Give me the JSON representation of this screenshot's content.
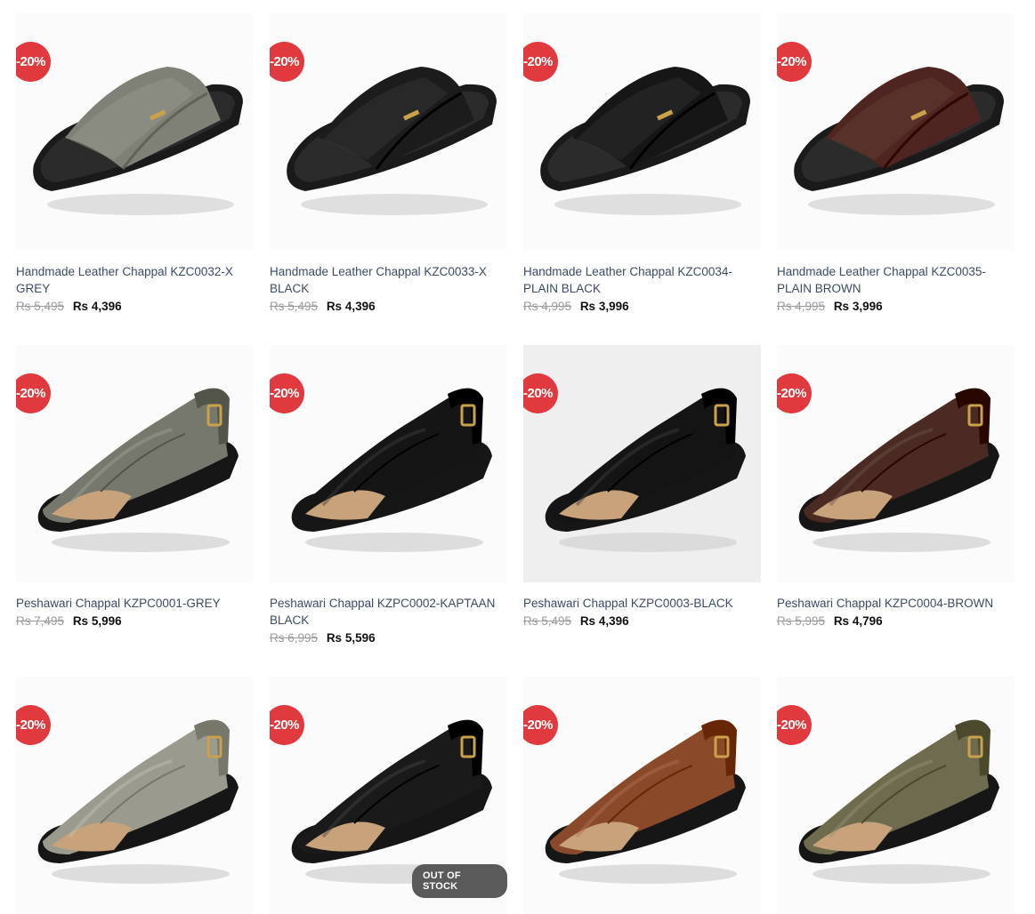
{
  "colors": {
    "badge": "#e03a3e",
    "title": "#3b4b66",
    "old_price": "#9a9a9a",
    "new_price": "#111111",
    "out_of_stock": "#5a5a5a"
  },
  "products": [
    {
      "title": "Handmade Leather Chappal KZC0032-X GREY",
      "old_price": "Rs 5,495",
      "price": "Rs 4,396",
      "discount": "-20%",
      "color": "#7f8076",
      "style": "slide",
      "image_icon": "grey-cross-strap-chappal-icon"
    },
    {
      "title": "Handmade Leather Chappal KZC0033-X BLACK",
      "old_price": "Rs 5,495",
      "price": "Rs 4,396",
      "discount": "-20%",
      "color": "#1c1c1c",
      "style": "slide",
      "image_icon": "black-cross-strap-chappal-icon"
    },
    {
      "title": "Handmade Leather Chappal KZC0034-PLAIN BLACK",
      "old_price": "Rs 4,995",
      "price": "Rs 3,996",
      "discount": "-20%",
      "color": "#161616",
      "style": "slide",
      "image_icon": "black-plain-chappal-icon"
    },
    {
      "title": "Handmade Leather Chappal KZC0035-PLAIN BROWN",
      "old_price": "Rs 4,995",
      "price": "Rs 3,996",
      "discount": "-20%",
      "color": "#4e2520",
      "style": "slide",
      "image_icon": "brown-plain-chappal-icon"
    },
    {
      "title": "Peshawari Chappal KZPC0001-GREY",
      "old_price": "Rs 7,495",
      "price": "Rs 5,996",
      "discount": "-20%",
      "color": "#76786d",
      "style": "peshawari",
      "image_icon": "grey-peshawari-chappal-icon"
    },
    {
      "title": "Peshawari Chappal KZPC0002-KAPTAAN BLACK",
      "old_price": "Rs 6,995",
      "price": "Rs 5,596",
      "discount": "-20%",
      "color": "#151515",
      "style": "peshawari",
      "image_icon": "black-kaptaan-chappal-icon"
    },
    {
      "title": "Peshawari Chappal KZPC0003-BLACK",
      "old_price": "Rs 5,495",
      "price": "Rs 4,396",
      "discount": "-20%",
      "color": "#141414",
      "style": "peshawari",
      "image_icon": "black-peshawari-chappal-icon"
    },
    {
      "title": "Peshawari Chappal KZPC0004-BROWN",
      "old_price": "Rs 5,995",
      "price": "Rs 4,796",
      "discount": "-20%",
      "color": "#4a2a22",
      "style": "peshawari",
      "image_icon": "brown-peshawari-chappal-icon"
    },
    {
      "title": "",
      "old_price": "",
      "price": "",
      "discount": "-20%",
      "color": "#9b9a8e",
      "style": "peshawari",
      "image_icon": "grey-suede-peshawari-chappal-icon"
    },
    {
      "title": "",
      "old_price": "",
      "price": "",
      "discount": "-20%",
      "color": "#1a1a1a",
      "style": "peshawari",
      "image_icon": "black-buckle-peshawari-chappal-icon",
      "out_of_stock": "OUT OF STOCK"
    },
    {
      "title": "",
      "old_price": "",
      "price": "",
      "discount": "-20%",
      "color": "#8a4a2a",
      "style": "peshawari",
      "image_icon": "tan-peshawari-chappal-icon"
    },
    {
      "title": "",
      "old_price": "",
      "price": "",
      "discount": "-20%",
      "color": "#6e6b4f",
      "style": "peshawari",
      "image_icon": "olive-peshawari-chappal-icon"
    }
  ]
}
